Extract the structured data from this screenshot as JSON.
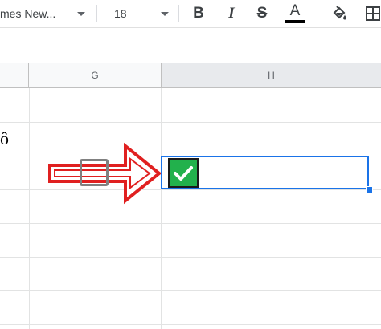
{
  "toolbar": {
    "font_family": "mes New...",
    "font_size": "18",
    "bold_label": "B",
    "italic_label": "I",
    "strike_label": "S",
    "text_color_label": "A",
    "text_color": "#000000",
    "fill_icon": "paint-bucket-icon",
    "borders_icon": "borders-icon"
  },
  "columns": [
    {
      "letter": "G"
    },
    {
      "letter": "H"
    }
  ],
  "cells": {
    "f_row3_text": "ô"
  },
  "checkboxes": {
    "g_row4_checked": false,
    "h_row4_checked": true
  },
  "annotation": {
    "arrow_color": "#e02020",
    "icon": "right-arrow-icon"
  },
  "colors": {
    "selection": "#1a73e8",
    "checkbox_fill": "#22b14c"
  }
}
